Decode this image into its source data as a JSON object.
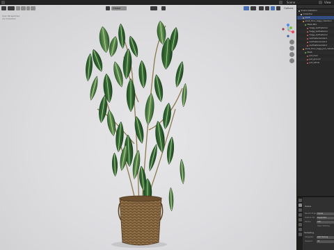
{
  "topbar": {
    "scene_label": "Scene",
    "view_layer_label": "View Layer"
  },
  "viewport": {
    "transform_orientation": "Global",
    "options_label": "Options",
    "info_lines": [
      "User Perspective",
      "(1) Collection"
    ],
    "axis_colors": {
      "x": "#e84a5f",
      "y": "#7fbf3f",
      "z": "#4a8ae8"
    }
  },
  "outliner": {
    "rows": [
      {
        "label": "Scene Collection",
        "indent": 0,
        "color": "#bdbdbd"
      },
      {
        "label": "Collection",
        "indent": 1,
        "color": "#e0e0e0"
      },
      {
        "label": "plant",
        "indent": 2,
        "color": "#e8a04a",
        "selected": true
      },
      {
        "label": "plant_ficus_bagg_collection",
        "indent": 2,
        "color": "#e8a04a"
      },
      {
        "label": "Mesh.001",
        "indent": 3,
        "color": "#6fb24a"
      },
      {
        "label": "twigg_leafmaterial",
        "indent": 4,
        "color": "#e06060"
      },
      {
        "label": "twigg_leafmaterial",
        "indent": 4,
        "color": "#e06060"
      },
      {
        "label": "twigg_leafmaterial",
        "indent": 4,
        "color": "#e06060"
      },
      {
        "label": "leafmaterial.blend",
        "indent": 4,
        "color": "#e06060"
      },
      {
        "label": "leafmaterial.blend",
        "indent": 4,
        "color": "#e06060"
      },
      {
        "label": "leafmaterial.blend",
        "indent": 4,
        "color": "#e06060"
      },
      {
        "label": "plant_ficus_bagg_pot_collection",
        "indent": 2,
        "color": "#e8a04a"
      },
      {
        "label": "Mesh",
        "indent": 3,
        "color": "#6fb24a"
      },
      {
        "label": "pot_bark",
        "indent": 4,
        "color": "#e06060"
      },
      {
        "label": "pot_ground",
        "indent": 4,
        "color": "#e06060"
      },
      {
        "label": "pot_willow",
        "indent": 4,
        "color": "#e06060"
      }
    ]
  },
  "properties": {
    "title": "Scene",
    "rows": [
      {
        "label": "Render Engine",
        "value": "Cycles"
      },
      {
        "label": "Feature Set",
        "value": "Supported"
      },
      {
        "label": "Device",
        "value": "CPU"
      },
      {
        "label": "",
        "value": "Open Shading"
      }
    ],
    "section": "Sampling",
    "bottom_rows": [
      {
        "label": "Integrator",
        "value": "Path Tracing"
      },
      {
        "label": "Viewport",
        "value": "32"
      }
    ]
  }
}
